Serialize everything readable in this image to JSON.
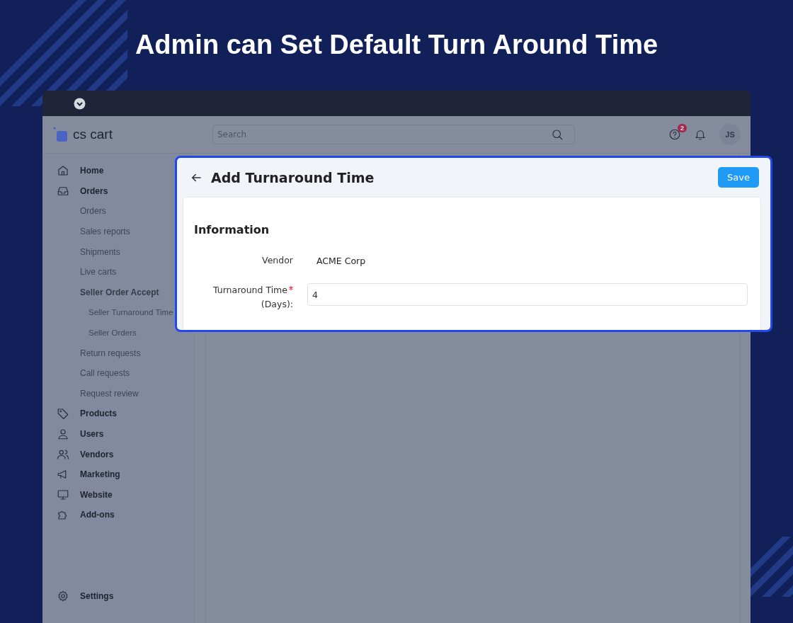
{
  "headline": "Admin can Set Default Turn Around Time",
  "app": {
    "logo": "cs cart",
    "search": {
      "placeholder": "Search"
    },
    "help_badge": "2",
    "avatar": "JS",
    "sidebar": {
      "items": [
        {
          "label": "Home"
        },
        {
          "label": "Orders",
          "children": [
            {
              "label": "Orders"
            },
            {
              "label": "Sales reports"
            },
            {
              "label": "Shipments"
            },
            {
              "label": "Live carts"
            },
            {
              "label": "Seller Order Accept",
              "children": [
                {
                  "label": "Seller Turnaround Time"
                },
                {
                  "label": "Seller Orders"
                }
              ]
            },
            {
              "label": "Return requests"
            },
            {
              "label": "Call requests"
            },
            {
              "label": "Request review"
            }
          ]
        },
        {
          "label": "Products"
        },
        {
          "label": "Users"
        },
        {
          "label": "Vendors"
        },
        {
          "label": "Marketing"
        },
        {
          "label": "Website"
        },
        {
          "label": "Add-ons"
        }
      ],
      "settings": "Settings"
    }
  },
  "dialog": {
    "title": "Add Turnaround Time",
    "save": "Save",
    "section": "Information",
    "fields": [
      {
        "kind": "text",
        "label": "Vendor",
        "value": "ACME Corp",
        "required": false
      },
      {
        "kind": "input",
        "label": "Turnaround Time",
        "label_2": "(Days):",
        "value": "4",
        "required": true
      }
    ]
  }
}
